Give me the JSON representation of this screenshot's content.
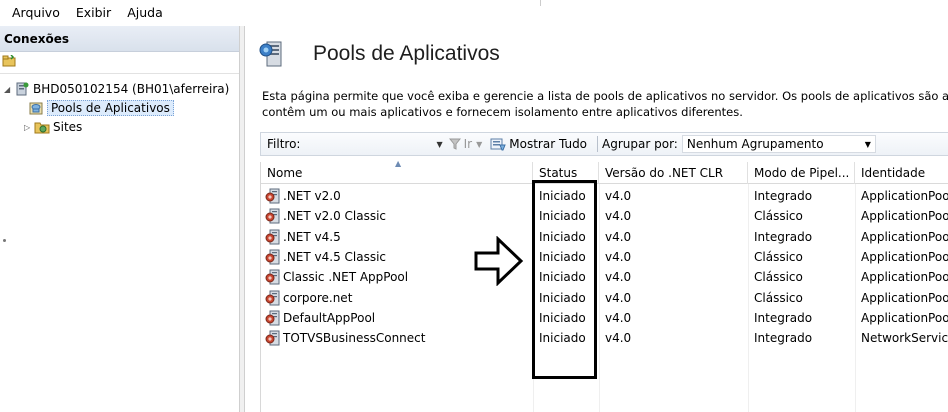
{
  "menubar": {
    "items": [
      "Arquivo",
      "Exibir",
      "Ajuda"
    ]
  },
  "connections": {
    "header": "Conexões",
    "tree": [
      {
        "label": "BHD050102154 (BH01\\aferreira)"
      },
      {
        "label": "Pools de Aplicativos"
      },
      {
        "label": "Sites"
      }
    ]
  },
  "page": {
    "title": "Pools de Aplicativos",
    "description_line1": "Esta página permite que você exiba e gerencie a lista de pools de aplicativos no servidor. Os pools de aplicativos são assoc",
    "description_line2": "contêm um ou mais aplicativos e fornecem isolamento entre aplicativos diferentes."
  },
  "filterbar": {
    "filter_label": "Filtro:",
    "filter_value": "",
    "go_label": "Ir",
    "show_all_label": "Mostrar Tudo",
    "group_label": "Agrupar por:",
    "group_value": "Nenhum Agrupamento"
  },
  "grid": {
    "columns": [
      "Nome",
      "Status",
      "Versão do .NET CLR",
      "Modo de Pipel...",
      "Identidade"
    ],
    "rows": [
      {
        "name": ".NET v2.0",
        "status": "Iniciado",
        "clr": "v4.0",
        "pipeline": "Integrado",
        "identity": "ApplicationPool"
      },
      {
        "name": ".NET v2.0 Classic",
        "status": "Iniciado",
        "clr": "v4.0",
        "pipeline": "Clássico",
        "identity": "ApplicationPool"
      },
      {
        "name": ".NET v4.5",
        "status": "Iniciado",
        "clr": "v4.0",
        "pipeline": "Integrado",
        "identity": "ApplicationPool"
      },
      {
        "name": ".NET v4.5 Classic",
        "status": "Iniciado",
        "clr": "v4.0",
        "pipeline": "Clássico",
        "identity": "ApplicationPool"
      },
      {
        "name": "Classic .NET AppPool",
        "status": "Iniciado",
        "clr": "v4.0",
        "pipeline": "Clássico",
        "identity": "ApplicationPool"
      },
      {
        "name": "corpore.net",
        "status": "Iniciado",
        "clr": "v4.0",
        "pipeline": "Clássico",
        "identity": "ApplicationPool"
      },
      {
        "name": "DefaultAppPool",
        "status": "Iniciado",
        "clr": "v4.0",
        "pipeline": "Integrado",
        "identity": "ApplicationPool"
      },
      {
        "name": "TOTVSBusinessConnect",
        "status": "Iniciado",
        "clr": "v4.0",
        "pipeline": "Integrado",
        "identity": "NetworkService"
      }
    ]
  },
  "colors": {
    "header_gradient_top": "#e9eef6",
    "selection": "#dcebfc",
    "title": "#1e1e1e"
  },
  "icons": {
    "toolbar": "connect-icon",
    "server": "server-icon",
    "pools": "app-pool-icon",
    "sites": "sites-folder-icon",
    "page": "app-pool-page-icon",
    "pool_row": "app-pool-icon",
    "annotation": "right-arrow-annotation-icon"
  }
}
